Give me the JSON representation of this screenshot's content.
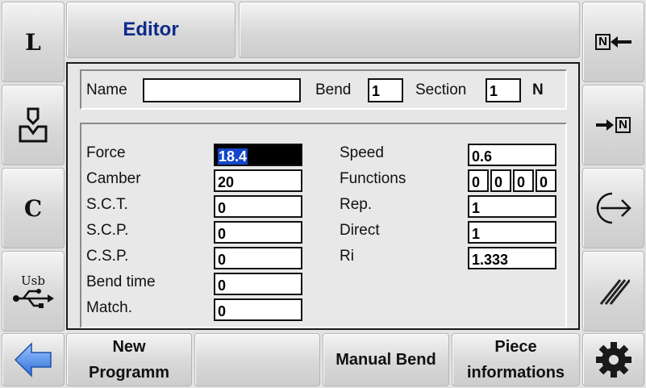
{
  "header": {
    "title": "Editor",
    "empty_tab": ""
  },
  "left_buttons": [
    {
      "name": "l-button",
      "label": "L"
    },
    {
      "name": "die-button",
      "icon": "die-icon"
    },
    {
      "name": "c-button",
      "label": "C"
    },
    {
      "name": "usb-button",
      "label": "Usb",
      "icon": "usb-icon"
    }
  ],
  "right_buttons": [
    {
      "name": "insert-before-button",
      "icon": "n-arrow-left-icon",
      "label": "N"
    },
    {
      "name": "insert-after-button",
      "icon": "arrow-right-n-icon",
      "label": "N"
    },
    {
      "name": "enter-button",
      "icon": "enter-icon"
    },
    {
      "name": "slash-button",
      "icon": "slash-icon"
    }
  ],
  "bottom": {
    "back_icon": "back-arrow-icon",
    "new_programm": [
      "New",
      "Programm"
    ],
    "empty": "",
    "manual_bend": "Manual Bend",
    "piece_informations": [
      "Piece",
      "informations"
    ],
    "settings_icon": "gear-icon"
  },
  "top_row": {
    "name_label": "Name",
    "name_value": "",
    "bend_label": "Bend",
    "bend_value": "1",
    "section_label": "Section",
    "section_value": "1",
    "n_label": "N"
  },
  "params_left": [
    {
      "label": "Force",
      "value": "18.4"
    },
    {
      "label": "Camber",
      "value": "20"
    },
    {
      "label": "S.C.T.",
      "value": "0"
    },
    {
      "label": "S.C.P.",
      "value": "0"
    },
    {
      "label": "C.S.P.",
      "value": "0"
    },
    {
      "label": "Bend time",
      "value": "0"
    },
    {
      "label": "Match.",
      "value": "0"
    }
  ],
  "params_right": [
    {
      "label": "Speed",
      "value": "0.6"
    },
    {
      "label": "Functions",
      "values": [
        "0",
        "0",
        "0",
        "0"
      ]
    },
    {
      "label": "Rep.",
      "value": "1"
    },
    {
      "label": "Direct",
      "value": "1"
    },
    {
      "label": "Ri",
      "value": "1.333"
    }
  ],
  "colors": {
    "title": "#0d2a8a",
    "selected_field": "#000000",
    "selected_text_bg": "#1546c9",
    "back_arrow": "#3f7fe0"
  }
}
